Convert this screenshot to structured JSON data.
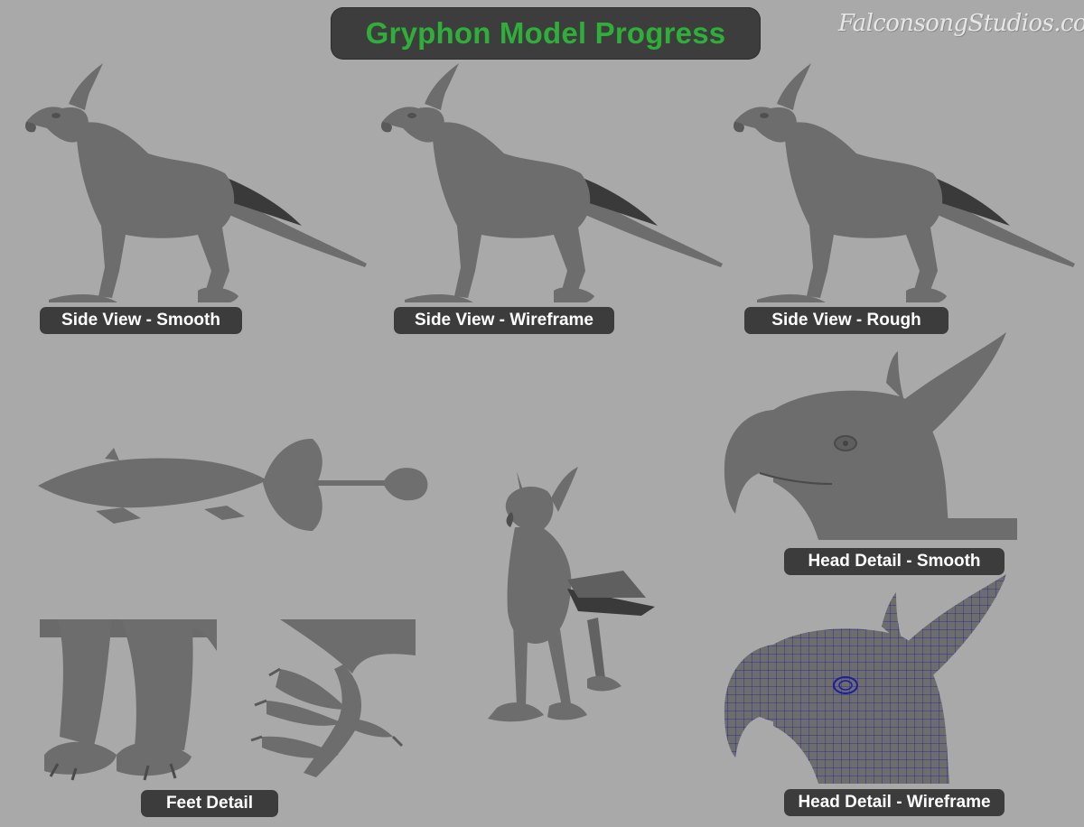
{
  "title": "Gryphon Model Progress",
  "brand": "FalconsongStudios.com",
  "labels": {
    "side_smooth": "Side View - Smooth",
    "side_wireframe": "Side View - Wireframe",
    "side_rough": "Side View - Rough",
    "head_smooth": "Head Detail - Smooth",
    "head_wireframe": "Head Detail - Wireframe",
    "feet": "Feet Detail"
  },
  "colors": {
    "background": "#a9a9a9",
    "title_text": "#2fae3a",
    "pill": "#3c3c3c",
    "model": "#6d6d6d",
    "wire": "#1e1e9e"
  }
}
